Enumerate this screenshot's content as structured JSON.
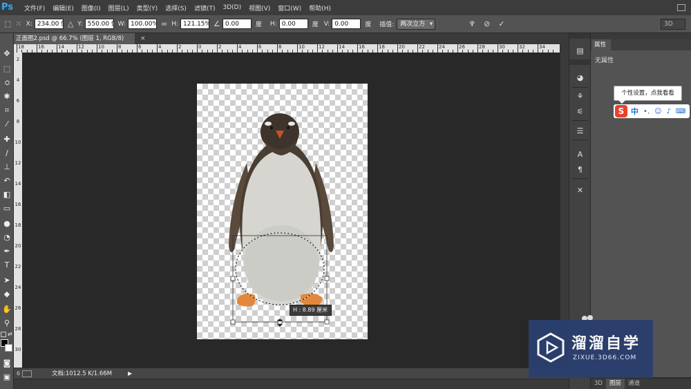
{
  "app": {
    "logo": "Ps"
  },
  "menubar": {
    "items": [
      {
        "label": "文件(F)"
      },
      {
        "label": "编辑(E)"
      },
      {
        "label": "图像(I)"
      },
      {
        "label": "图层(L)"
      },
      {
        "label": "类型(Y)"
      },
      {
        "label": "选择(S)"
      },
      {
        "label": "滤镜(T)"
      },
      {
        "label": "3D(D)"
      },
      {
        "label": "视图(V)"
      },
      {
        "label": "窗口(W)"
      },
      {
        "label": "帮助(H)"
      }
    ]
  },
  "options": {
    "x_label": "X:",
    "x_value": "234.00 像",
    "y_label": "Y:",
    "y_value": "550.00 像",
    "w_label": "W:",
    "w_value": "100.00%",
    "h_label": "H:",
    "h_value": "121.15%",
    "angle_value": "0.00",
    "angle_unit": "度",
    "hskew_label": "H:",
    "hskew_value": "0.00",
    "hskew_unit": "度",
    "vskew_label": "V:",
    "vskew_value": "0.00",
    "vskew_unit": "度",
    "interp_label": "插值:",
    "interp_value": "两次立方",
    "workspace": "3D"
  },
  "document": {
    "tab_title": "正面图2.psd @ 66.7% (图层 1, RGB/8)",
    "tab_close": "×",
    "status_zoom": "6",
    "status_info": "文档:1012.5 K/1.66M",
    "status_arrow": "▶"
  },
  "ruler": {
    "h_labels": [
      "18",
      "16",
      "14",
      "12",
      "10",
      "8",
      "6",
      "4",
      "2",
      "0",
      "2",
      "4",
      "6",
      "8",
      "10",
      "12",
      "14",
      "16",
      "18",
      "20",
      "22",
      "24",
      "26",
      "28",
      "30",
      "32",
      "34"
    ],
    "v_labels": [
      "2",
      "4",
      "6",
      "8",
      "10",
      "12",
      "14",
      "16",
      "18",
      "20",
      "22",
      "24",
      "26",
      "28",
      "30"
    ]
  },
  "transform_hud": {
    "text": "H : 8.89 厘米"
  },
  "right_panel": {
    "tab": "属性",
    "body": "无属性",
    "bottom_tabs": [
      "3D",
      "图层",
      "通道"
    ],
    "active_bottom_tab": "图层"
  },
  "ime": {
    "tooltip": "个性设置，点我看看",
    "logo": "S",
    "lang": "中",
    "icons": [
      "punctuation-icon",
      "emoji-icon",
      "microphone-icon",
      "keyboard-icon"
    ]
  },
  "watermark": {
    "title": "溜溜自学",
    "url": "ZIXUE.3D66.COM"
  },
  "tools": [
    "move-tool-icon",
    "marquee-tool-icon",
    "lasso-tool-icon",
    "magic-wand-tool-icon",
    "crop-tool-icon",
    "eyedropper-tool-icon",
    "healing-brush-tool-icon",
    "brush-tool-icon",
    "clone-stamp-tool-icon",
    "history-brush-tool-icon",
    "eraser-tool-icon",
    "gradient-tool-icon",
    "blur-tool-icon",
    "dodge-tool-icon",
    "pen-tool-icon",
    "type-tool-icon",
    "path-selection-tool-icon",
    "shape-tool-icon",
    "hand-tool-icon",
    "zoom-tool-icon"
  ],
  "colors": {
    "ps_blue": "#31a8ff",
    "panel_gray": "#535353",
    "canvas_bg": "#282828",
    "watermark_blue": "#2b3f6e",
    "ime_red": "#e8412f"
  }
}
